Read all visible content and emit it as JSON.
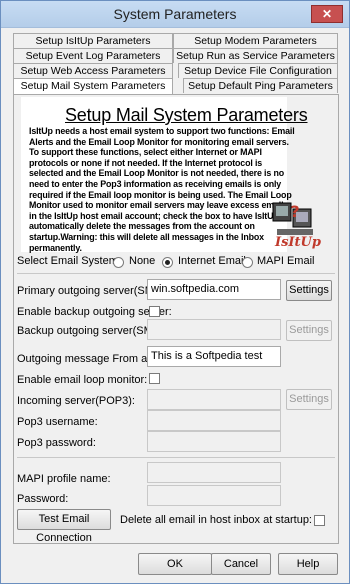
{
  "window": {
    "title": "System Parameters",
    "close_glyph": "✕"
  },
  "tabs": {
    "row1": [
      "Setup IsItUp Parameters",
      "Setup Modem Parameters"
    ],
    "row2": [
      "Setup Event Log Parameters",
      "Setup Run as Service Parameters"
    ],
    "row3": [
      "Setup Web Access Parameters",
      "Setup Device File Configuration"
    ],
    "row4": [
      "Setup Mail System Parameters",
      "Setup Default Ping Parameters"
    ],
    "active": "Setup Mail System Parameters"
  },
  "info": {
    "heading": "Setup Mail System Parameters",
    "body": "IsItUp needs a host email system to support two functions: Email Alerts and the Email Loop Monitor for monitoring email servers.  To support these functions, select either Internet or MAPI protocols or none if not needed.  If the Internet protocol is selected and the Email Loop Monitor is not needed, there is no need to enter the Pop3 information as receiving emails is only required if the Email loop monitor is being used.  The Email Loop Monitor used to monitor email servers may leave excess emails in the IsItUp host email account; check the box to have IsItUp automatically delete the messages from the account on startup.Warning: this will delete all messages in the Inbox permanently.",
    "logo_text": "IsItUp"
  },
  "email_system": {
    "label": "Select Email System:",
    "options": [
      "None",
      "Internet Email",
      "MAPI Email"
    ],
    "selected": "Internet Email"
  },
  "form": {
    "primary_smtp_label": "Primary outgoing server(SMTP):",
    "primary_smtp_value": "win.softpedia.com",
    "settings_label": "Settings",
    "enable_backup_label": "Enable backup outgoing server:",
    "backup_smtp_label": "Backup outgoing server(SMTP):",
    "backup_smtp_value": "",
    "from_label": "Outgoing message From address:",
    "from_value": "This is a Softpedia test",
    "loop_monitor_label": "Enable email loop monitor:",
    "pop3_server_label": "Incoming server(POP3):",
    "pop3_server_value": "",
    "pop3_user_label": "Pop3 username:",
    "pop3_user_value": "",
    "pop3_pass_label": "Pop3 password:",
    "pop3_pass_value": "",
    "mapi_profile_label": "MAPI profile name:",
    "mapi_profile_value": "",
    "password_label": "Password:",
    "password_value": "",
    "test_button": "Test Email Connection",
    "delete_inbox_label": "Delete all email in host inbox at startup:"
  },
  "footer": {
    "ok": "OK",
    "cancel": "Cancel",
    "help": "Help"
  },
  "colors": {
    "titlebar": "#c7dcf3",
    "close": "#c75050",
    "logo_red": "#c0392b"
  },
  "icons": [
    "close-icon",
    "isitup-logo-icon"
  ]
}
